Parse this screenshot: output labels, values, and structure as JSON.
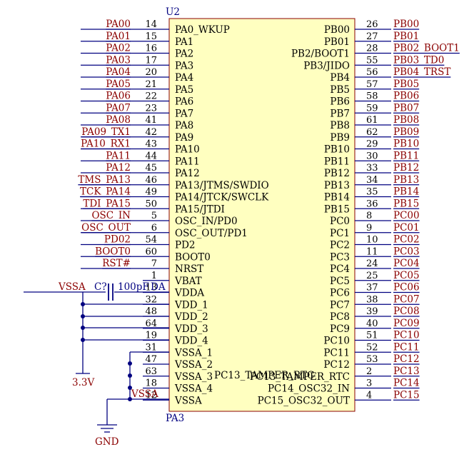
{
  "component": {
    "designator": "U2",
    "part": "PA3"
  },
  "left_pins": [
    {
      "net": "PA00",
      "num": "14",
      "name": "PA0_WKUP"
    },
    {
      "net": "PA01",
      "num": "15",
      "name": "PA1"
    },
    {
      "net": "PA02",
      "num": "16",
      "name": "PA2"
    },
    {
      "net": "PA03",
      "num": "17",
      "name": "PA3"
    },
    {
      "net": "PA04",
      "num": "20",
      "name": "PA4"
    },
    {
      "net": "PA05",
      "num": "21",
      "name": "PA5"
    },
    {
      "net": "PA06",
      "num": "22",
      "name": "PA6"
    },
    {
      "net": "PA07",
      "num": "23",
      "name": "PA7"
    },
    {
      "net": "PA08",
      "num": "41",
      "name": "PA8"
    },
    {
      "net": "PA09_TX1",
      "num": "42",
      "name": "PA9"
    },
    {
      "net": "PA10_RX1",
      "num": "43",
      "name": "PA10"
    },
    {
      "net": "PA11",
      "num": "44",
      "name": "PA11"
    },
    {
      "net": "PA12",
      "num": "45",
      "name": "PA12"
    },
    {
      "net": "TMS_PA13",
      "num": "46",
      "name": "PA13/JTMS/SWDIO"
    },
    {
      "net": "TCK_PA14",
      "num": "49",
      "name": "PA14/JTCK/SWCLK"
    },
    {
      "net": "TDI_PA15",
      "num": "50",
      "name": "PA15/JTDI"
    },
    {
      "net": "OSC_IN",
      "num": "5",
      "name": "OSC_IN/PD0"
    },
    {
      "net": "OSC_OUT",
      "num": "6",
      "name": "OSC_OUT/PD1"
    },
    {
      "net": "PD02",
      "num": "54",
      "name": "PD2"
    },
    {
      "net": "BOOT0",
      "num": "60",
      "name": "BOOT0"
    },
    {
      "net": "RST#",
      "num": "7",
      "name": "NRST"
    },
    {
      "net": "",
      "num": "1",
      "name": "VBAT"
    },
    {
      "net": "",
      "num": "13",
      "name": "VDDA"
    },
    {
      "net": "",
      "num": "32",
      "name": "VDD_1"
    },
    {
      "net": "",
      "num": "48",
      "name": "VDD_2"
    },
    {
      "net": "",
      "num": "64",
      "name": "VDD_3"
    },
    {
      "net": "",
      "num": "19",
      "name": "VDD_4"
    },
    {
      "net": "",
      "num": "31",
      "name": "VSSA_1"
    },
    {
      "net": "",
      "num": "47",
      "name": "VSSA_2"
    },
    {
      "net": "",
      "num": "63",
      "name": "VSSA_3"
    },
    {
      "net": "",
      "num": "18",
      "name": "VSSA_4"
    },
    {
      "net": "",
      "num": "12",
      "name": "VSSA"
    }
  ],
  "right_pins": [
    {
      "net": "PB00",
      "num": "26",
      "name": "PB00"
    },
    {
      "net": "PB01",
      "num": "27",
      "name": "PB01"
    },
    {
      "net": "PB02_BOOT1",
      "num": "28",
      "name": "PB2/BOOT1"
    },
    {
      "net": "PB03_TD0",
      "num": "55",
      "name": "PB3/JIDO"
    },
    {
      "net": "PB04_TRST",
      "num": "56",
      "name": "PB4"
    },
    {
      "net": "PB05",
      "num": "57",
      "name": "PB5"
    },
    {
      "net": "PB06",
      "num": "58",
      "name": "PB6"
    },
    {
      "net": "PB07",
      "num": "59",
      "name": "PB7"
    },
    {
      "net": "PB08",
      "num": "61",
      "name": "PB8"
    },
    {
      "net": "PB09",
      "num": "62",
      "name": "PB9"
    },
    {
      "net": "PB10",
      "num": "29",
      "name": "PB10"
    },
    {
      "net": "PB11",
      "num": "30",
      "name": "PB11"
    },
    {
      "net": "PB12",
      "num": "33",
      "name": "PB12"
    },
    {
      "net": "PB13",
      "num": "34",
      "name": "PB13"
    },
    {
      "net": "PB14",
      "num": "35",
      "name": "PB14"
    },
    {
      "net": "PB15",
      "num": "36",
      "name": "PB15"
    },
    {
      "net": "PC00",
      "num": "8",
      "name": "PC0"
    },
    {
      "net": "PC01",
      "num": "9",
      "name": "PC1"
    },
    {
      "net": "PC02",
      "num": "10",
      "name": "PC2"
    },
    {
      "net": "PC03",
      "num": "11",
      "name": "PC3"
    },
    {
      "net": "PC04",
      "num": "24",
      "name": "PC4"
    },
    {
      "net": "PC05",
      "num": "25",
      "name": "PC5"
    },
    {
      "net": "PC06",
      "num": "37",
      "name": "PC6"
    },
    {
      "net": "PC07",
      "num": "38",
      "name": "PC7"
    },
    {
      "net": "PC08",
      "num": "39",
      "name": "PC8"
    },
    {
      "net": "PC09",
      "num": "40",
      "name": "PC9"
    },
    {
      "net": "PC10",
      "num": "51",
      "name": "PC10"
    },
    {
      "net": "PC11",
      "num": "52",
      "name": "PC11"
    },
    {
      "net": "PC12",
      "num": "53",
      "name": "PC12"
    },
    {
      "net": "PC13",
      "num": "2",
      "name": "PC13_TAMPER_RTC"
    },
    {
      "net": "PC14",
      "num": "3",
      "name": "PC14_OSC32_IN"
    },
    {
      "net": "PC15",
      "num": "4",
      "name": "PC15_OSC32_OUT"
    }
  ],
  "overlap_label": "PC13_TAMPER_RTC",
  "capacitor": {
    "net": "VSSA",
    "designator": "C?",
    "value": "100pF",
    "tail": "DA"
  },
  "power": {
    "supply": "3.3V",
    "ground": "GND",
    "vssa_tag": "VSSA"
  },
  "colors": {
    "body_fill": "#ffffc0",
    "body_stroke": "#8b0000",
    "wire": "#000080",
    "net_label": "#8b0000",
    "designator": "#000080",
    "pin_text": "#000000"
  }
}
